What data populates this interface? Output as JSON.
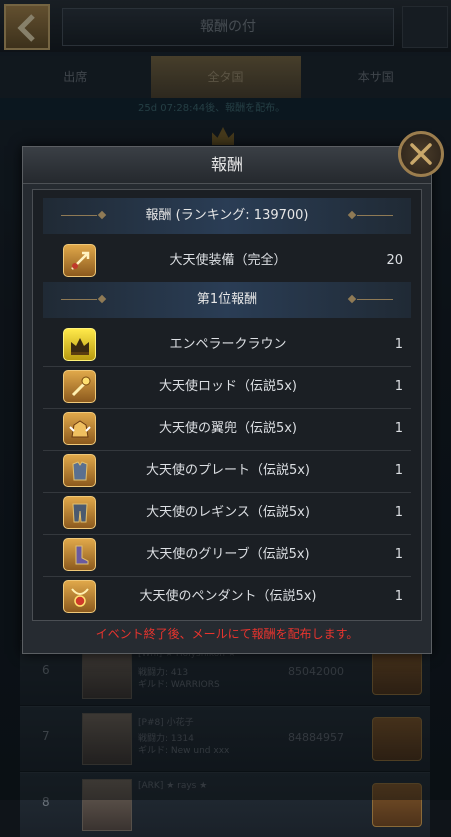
{
  "background": {
    "title": "報酬の付",
    "tabs": [
      "出席",
      "全タ国",
      "本サ国"
    ],
    "active_tab_index": 1,
    "notice": "25d 07:28:44後、報酬を配布。",
    "rows": [
      {
        "rank": "6",
        "line1": "[Whi] ★ Holyshikon ★",
        "line2": "戦闘力: 413",
        "line3": "ギルド: WARRIORS",
        "score": "85042000"
      },
      {
        "rank": "7",
        "line1": "[P#8] 小花子",
        "line2": "戦闘力: 1314",
        "line3": "ギルド: New und xxx",
        "score": "84884957"
      },
      {
        "rank": "8",
        "line1": "[ARK] ★ rays ★",
        "line2": "",
        "line3": "",
        "score": ""
      }
    ]
  },
  "modal": {
    "title": "報酬",
    "section1": "報酬 (ランキング: 139700)",
    "first_item": {
      "name": "大天使装備（完全）",
      "qty": "20",
      "icon": "archangel-gear-icon"
    },
    "section2": "第1位報酬",
    "items": [
      {
        "name": "エンペラークラウン",
        "qty": "1",
        "icon": "emperor-crown-icon"
      },
      {
        "name": "大天使ロッド（伝説5x)",
        "qty": "1",
        "icon": "rod-icon"
      },
      {
        "name": "大天使の翼兜（伝説5x)",
        "qty": "1",
        "icon": "helm-icon"
      },
      {
        "name": "大天使のプレート（伝説5x)",
        "qty": "1",
        "icon": "plate-armor-icon"
      },
      {
        "name": "大天使のレギンス（伝説5x)",
        "qty": "1",
        "icon": "leggings-icon"
      },
      {
        "name": "大天使のグリーブ（伝説5x)",
        "qty": "1",
        "icon": "greaves-icon"
      },
      {
        "name": "大天使のペンダント（伝説5x)",
        "qty": "1",
        "icon": "pendant-icon"
      }
    ],
    "footer": "イベント終了後、メールにて報酬を配布します。"
  },
  "colors": {
    "accent_gold": "#9c7e4e",
    "footer_red": "#e8342e",
    "section_blue": "#2a3d55"
  }
}
